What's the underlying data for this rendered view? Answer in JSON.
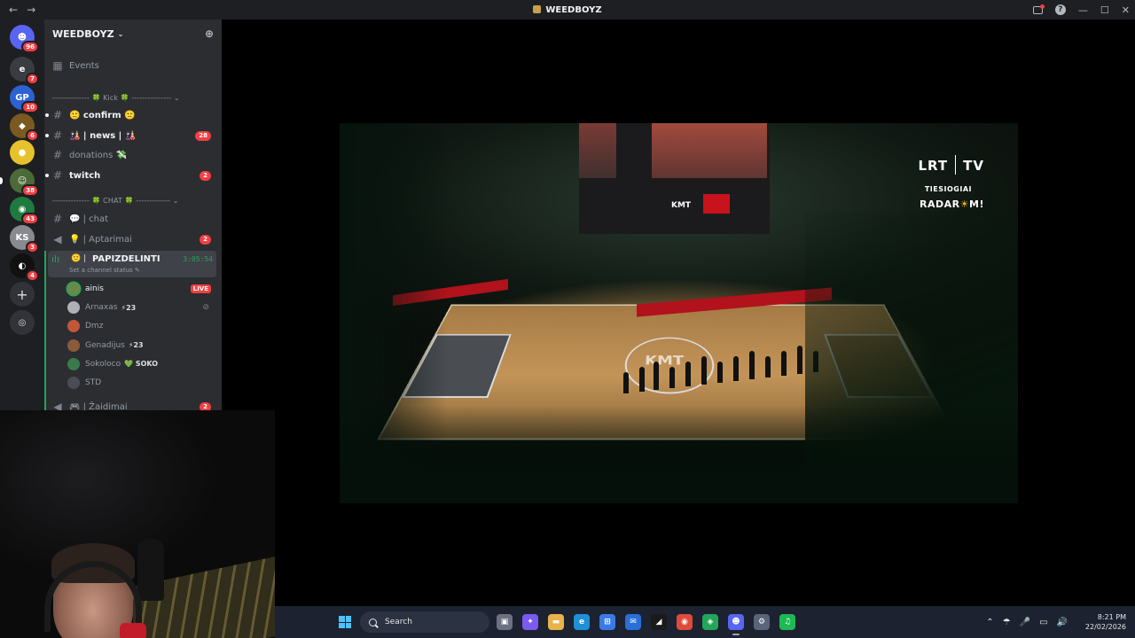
{
  "window": {
    "title": "WEEDBOYZ",
    "back_glyph": "←",
    "forward_glyph": "→",
    "minimize_glyph": "—",
    "maximize_glyph": "☐",
    "close_glyph": "✕"
  },
  "servers": [
    {
      "name": "discord-home",
      "glyph": "☻",
      "badge": "96",
      "color": "#5865f2"
    },
    {
      "name": "server-e",
      "glyph": "e",
      "badge": "7",
      "color": "#3a3c42"
    },
    {
      "name": "server-gp",
      "glyph": "GP",
      "badge": "10",
      "color": "#2c62d1"
    },
    {
      "name": "server-bee",
      "glyph": "◆",
      "badge": "6",
      "color": "#7a5a20"
    },
    {
      "name": "server-yellow",
      "glyph": "●",
      "badge": "",
      "color": "#e6c22c"
    },
    {
      "name": "server-green-man",
      "glyph": "☺",
      "badge": "38",
      "color": "#4a6a38"
    },
    {
      "name": "server-dark",
      "glyph": "◉",
      "badge": "43",
      "color": "#1f7a3f"
    },
    {
      "name": "server-ks",
      "glyph": "KS",
      "badge": "3",
      "color": "#888a90"
    },
    {
      "name": "server-black",
      "glyph": "◐",
      "badge": "4",
      "color": "#111111"
    }
  ],
  "add_server_glyph": "+",
  "discover_glyph": "◎",
  "guild": {
    "name": "WEEDBOYZ",
    "caret": "⌄",
    "add_member_glyph": "⊕",
    "events_label": "Events",
    "categories": {
      "kick": "-------------- 🍀 Kick 🍀 --------------- ⌄",
      "chat": "-------------- 🍀 CHAT 🍀 ------------- ⌄"
    },
    "text_channels": [
      {
        "label": "🙁 confirm 🙁",
        "unread": true,
        "badge": ""
      },
      {
        "label": "🎎 | news | 🎎",
        "unread": true,
        "badge": "28"
      },
      {
        "label": "donations 💸",
        "unread": false,
        "badge": ""
      },
      {
        "label": "twitch",
        "unread": true,
        "badge": "2"
      },
      {
        "label": "💬 | chat",
        "unread": false,
        "badge": ""
      },
      {
        "label": "💡 | Aptarimai",
        "unread": false,
        "badge": "2"
      }
    ],
    "active_voice": {
      "name": "PAPIZDELINTI",
      "emoji": "🙁 |",
      "status": "Set a channel status ✎",
      "timer": "3:05:54"
    },
    "members": [
      {
        "name": "ainis",
        "tag": "",
        "live": "LIVE",
        "color": "#6a8a4a",
        "bright": true,
        "speaking": true
      },
      {
        "name": "Arnaxas",
        "tag": "⚡23",
        "live": "",
        "color": "#b0b0b8",
        "bright": false,
        "speaking": false,
        "muted": true
      },
      {
        "name": "Dmz",
        "tag": "",
        "live": "",
        "color": "#c2553a",
        "bright": false,
        "speaking": false
      },
      {
        "name": "Genadijus",
        "tag": "⚡23",
        "live": "",
        "color": "#8a5a3a",
        "bright": false,
        "speaking": false
      },
      {
        "name": "Sokoloco",
        "tag": "💚 SOKO",
        "live": "",
        "color": "#3a7a4a",
        "bright": false,
        "speaking": false
      },
      {
        "name": "STD",
        "tag": "",
        "live": "",
        "color": "#4a4d55",
        "bright": false,
        "speaking": false
      }
    ],
    "last_voice": {
      "label": "🎮 | Žaidimai",
      "badge": "2"
    }
  },
  "stream": {
    "broadcaster": "LRT",
    "broadcaster_suffix": "TV",
    "live_label": "TIESIOGIAI",
    "radar_prefix": "RADAR",
    "radar_sun": "☀",
    "radar_suffix": "M!",
    "court_logo": "KMT",
    "jumbo_brand": "KMT"
  },
  "taskbar": {
    "search_placeholder": "Search",
    "apps": [
      {
        "name": "file-explorer-task",
        "glyph": "▣",
        "color": "#6a7282"
      },
      {
        "name": "copilot",
        "glyph": "✦",
        "color": "#7a5af0"
      },
      {
        "name": "folder",
        "glyph": "▬",
        "color": "#e8b34a"
      },
      {
        "name": "edge",
        "glyph": "e",
        "color": "#1f8fd8"
      },
      {
        "name": "store",
        "glyph": "⊞",
        "color": "#3a7ae8"
      },
      {
        "name": "mail",
        "glyph": "✉",
        "color": "#2a6ed8"
      },
      {
        "name": "capcut",
        "glyph": "◢",
        "color": "#1a1a1a"
      },
      {
        "name": "chrome",
        "glyph": "◉",
        "color": "#e04a3a"
      },
      {
        "name": "app-green",
        "glyph": "◈",
        "color": "#23a55a"
      },
      {
        "name": "discord",
        "glyph": "☻",
        "color": "#5865f2"
      },
      {
        "name": "settings",
        "glyph": "⚙",
        "color": "#5a6478"
      },
      {
        "name": "spotify",
        "glyph": "♫",
        "color": "#1db954"
      }
    ],
    "tray_glyphs": [
      "⌃",
      "☂",
      "🎤",
      "▭",
      "🔊"
    ],
    "time": "8:21 PM",
    "date": "22/02/2026"
  }
}
